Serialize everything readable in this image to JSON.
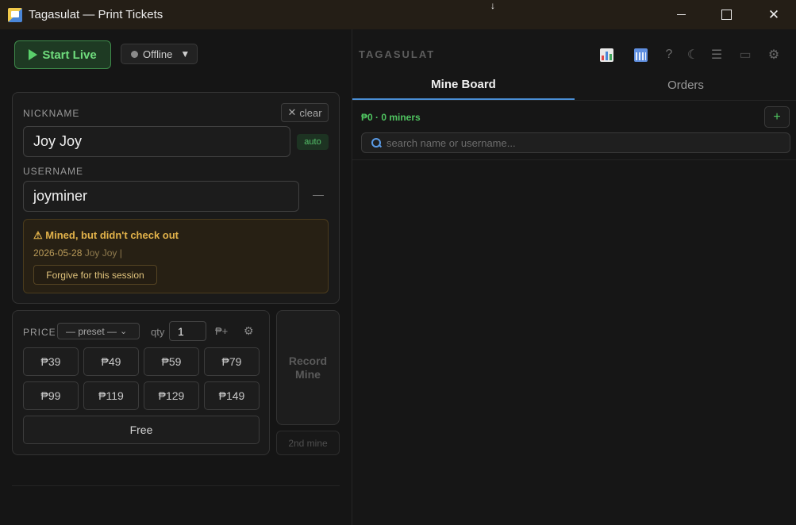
{
  "window": {
    "title": "Tagasulat — Print Tickets",
    "cursor": "↓"
  },
  "toolbar": {
    "start_live_label": "Start Live",
    "status_label": "Offline",
    "status_caret": "▼"
  },
  "entry": {
    "nickname_label": "NICKNAME",
    "nickname_value": "Joy Joy",
    "clear_label": "clear",
    "auto_badge": "auto",
    "username_label": "USERNAME",
    "username_value": "joyminer",
    "username_dash": "—"
  },
  "warning": {
    "title": "⚠ Mined, but didn't check out",
    "date": "2026-05-28",
    "name": "Joy Joy |",
    "forgive_label": "Forgive for this session"
  },
  "price": {
    "label": "PRICE",
    "preset_label": "— preset —",
    "qty_label": "qty",
    "qty_value": "1",
    "peso_plus_label": "₱+",
    "buttons": [
      "₱39",
      "₱49",
      "₱59",
      "₱79",
      "₱99",
      "₱119",
      "₱129",
      "₱149"
    ],
    "free_label": "Free"
  },
  "actions": {
    "record_line1": "Record",
    "record_line2": "Mine",
    "second_label": "2nd mine"
  },
  "right_header": {
    "brand": "TAGASULAT",
    "icons": [
      "chart-icon",
      "calendar-icon",
      "help-icon",
      "moon-icon",
      "menu-icon",
      "printer-icon",
      "gear-icon"
    ]
  },
  "tabs": {
    "mine_board": "Mine Board",
    "orders": "Orders"
  },
  "board": {
    "summary": "₱0 · 0 miners",
    "add_label": "+",
    "search_placeholder": "search name or username..."
  },
  "colors": {
    "accent_green": "#4fc460",
    "accent_blue": "#4a8fd6",
    "warning_amber": "#e2b24a"
  }
}
